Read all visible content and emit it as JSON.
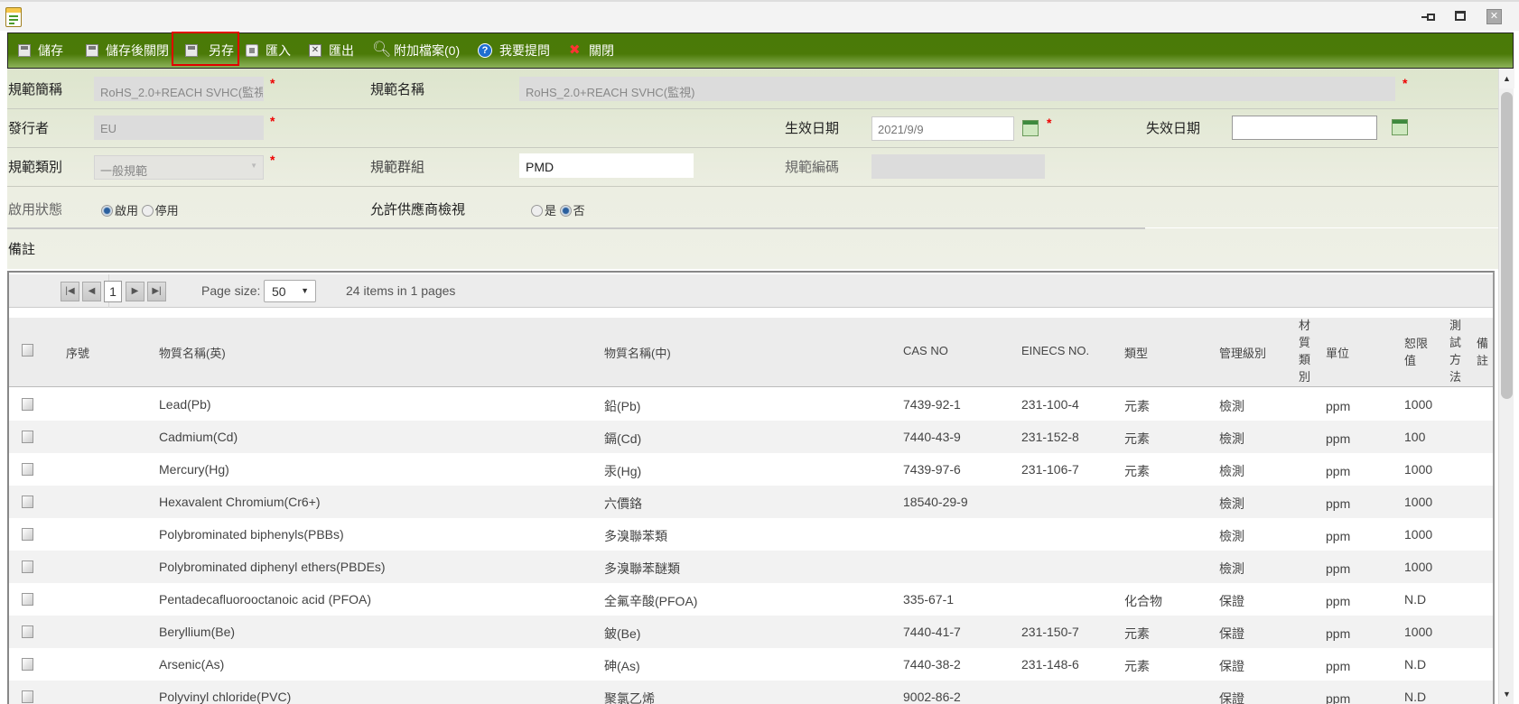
{
  "window": {
    "controls": [
      "pin-icon",
      "maximize-icon",
      "close-icon"
    ]
  },
  "toolbar": {
    "save": "儲存",
    "save_close": "儲存後關閉",
    "save_as": "另存",
    "import": "匯入",
    "export": "匯出",
    "attachments": "附加檔案(0)",
    "ask": "我要提問",
    "close": "關閉",
    "highlight_color": "#e00000",
    "bar_color": "#4a7a08"
  },
  "form": {
    "short_name": {
      "label": "規範簡稱",
      "value": "RoHS_2.0+REACH SVHC(監視"
    },
    "full_name": {
      "label": "規範名稱",
      "value": "RoHS_2.0+REACH SVHC(監視)"
    },
    "issuer": {
      "label": "發行者",
      "value": "EU"
    },
    "effective_date": {
      "label": "生效日期",
      "value": "2021/9/9"
    },
    "expiry_date": {
      "label": "失效日期",
      "value": ""
    },
    "category": {
      "label": "規範類別",
      "value": "一般規範"
    },
    "group": {
      "label": "規範群組",
      "value": "PMD"
    },
    "code": {
      "label": "規範編碼",
      "value": ""
    },
    "status": {
      "label": "啟用狀態",
      "options": [
        "啟用",
        "停用"
      ],
      "selected": "啟用"
    },
    "supplier_view": {
      "label": "允許供應商檢視",
      "options": [
        "是",
        "否"
      ],
      "selected": "否"
    },
    "remark": {
      "label": "備註"
    },
    "required_mark": "*"
  },
  "pager": {
    "page": "1",
    "page_size_label": "Page size:",
    "page_size": "50",
    "summary": "24 items in 1 pages"
  },
  "table": {
    "columns": [
      "序號",
      "物質名稱(英)",
      "物質名稱(中)",
      "CAS NO",
      "EINECS NO.",
      "類型",
      "管理級別",
      "材質類別",
      "單位",
      "恕限值",
      "測試方法",
      "備註"
    ],
    "rows": [
      {
        "seq": "",
        "en": "Lead(Pb)",
        "zh": "鉛(Pb)",
        "cas": "7439-92-1",
        "einecs": "231-100-4",
        "type": "元素",
        "level": "檢測",
        "material": "",
        "unit": "ppm",
        "limit": "1000",
        "method": "",
        "remark": ""
      },
      {
        "seq": "",
        "en": "Cadmium(Cd)",
        "zh": "鎘(Cd)",
        "cas": "7440-43-9",
        "einecs": "231-152-8",
        "type": "元素",
        "level": "檢測",
        "material": "",
        "unit": "ppm",
        "limit": "100",
        "method": "",
        "remark": ""
      },
      {
        "seq": "",
        "en": "Mercury(Hg)",
        "zh": "汞(Hg)",
        "cas": "7439-97-6",
        "einecs": "231-106-7",
        "type": "元素",
        "level": "檢測",
        "material": "",
        "unit": "ppm",
        "limit": "1000",
        "method": "",
        "remark": ""
      },
      {
        "seq": "",
        "en": "Hexavalent Chromium(Cr6+)",
        "zh": "六價鉻",
        "cas": "18540-29-9",
        "einecs": "",
        "type": "",
        "level": "檢測",
        "material": "",
        "unit": "ppm",
        "limit": "1000",
        "method": "",
        "remark": ""
      },
      {
        "seq": "",
        "en": "Polybrominated biphenyls(PBBs)",
        "zh": "多溴聯苯類",
        "cas": "",
        "einecs": "",
        "type": "",
        "level": "檢測",
        "material": "",
        "unit": "ppm",
        "limit": "1000",
        "method": "",
        "remark": ""
      },
      {
        "seq": "",
        "en": "Polybrominated diphenyl ethers(PBDEs)",
        "zh": "多溴聯苯醚類",
        "cas": "",
        "einecs": "",
        "type": "",
        "level": "檢測",
        "material": "",
        "unit": "ppm",
        "limit": "1000",
        "method": "",
        "remark": ""
      },
      {
        "seq": "",
        "en": "Pentadecafluorooctanoic acid (PFOA)",
        "zh": "全氟辛酸(PFOA)",
        "cas": "335-67-1",
        "einecs": "",
        "type": "化合物",
        "level": "保證",
        "material": "",
        "unit": "ppm",
        "limit": "N.D",
        "method": "",
        "remark": ""
      },
      {
        "seq": "",
        "en": "Beryllium(Be)",
        "zh": "鈹(Be)",
        "cas": "7440-41-7",
        "einecs": "231-150-7",
        "type": "元素",
        "level": "保證",
        "material": "",
        "unit": "ppm",
        "limit": "1000",
        "method": "",
        "remark": ""
      },
      {
        "seq": "",
        "en": "Arsenic(As)",
        "zh": "砷(As)",
        "cas": "7440-38-2",
        "einecs": "231-148-6",
        "type": "元素",
        "level": "保證",
        "material": "",
        "unit": "ppm",
        "limit": "N.D",
        "method": "",
        "remark": ""
      },
      {
        "seq": "",
        "en": "Polyvinyl chloride(PVC)",
        "zh": "聚氯乙烯",
        "cas": "9002-86-2",
        "einecs": "",
        "type": "",
        "level": "保證",
        "material": "",
        "unit": "ppm",
        "limit": "N.D",
        "method": "",
        "remark": ""
      }
    ]
  }
}
